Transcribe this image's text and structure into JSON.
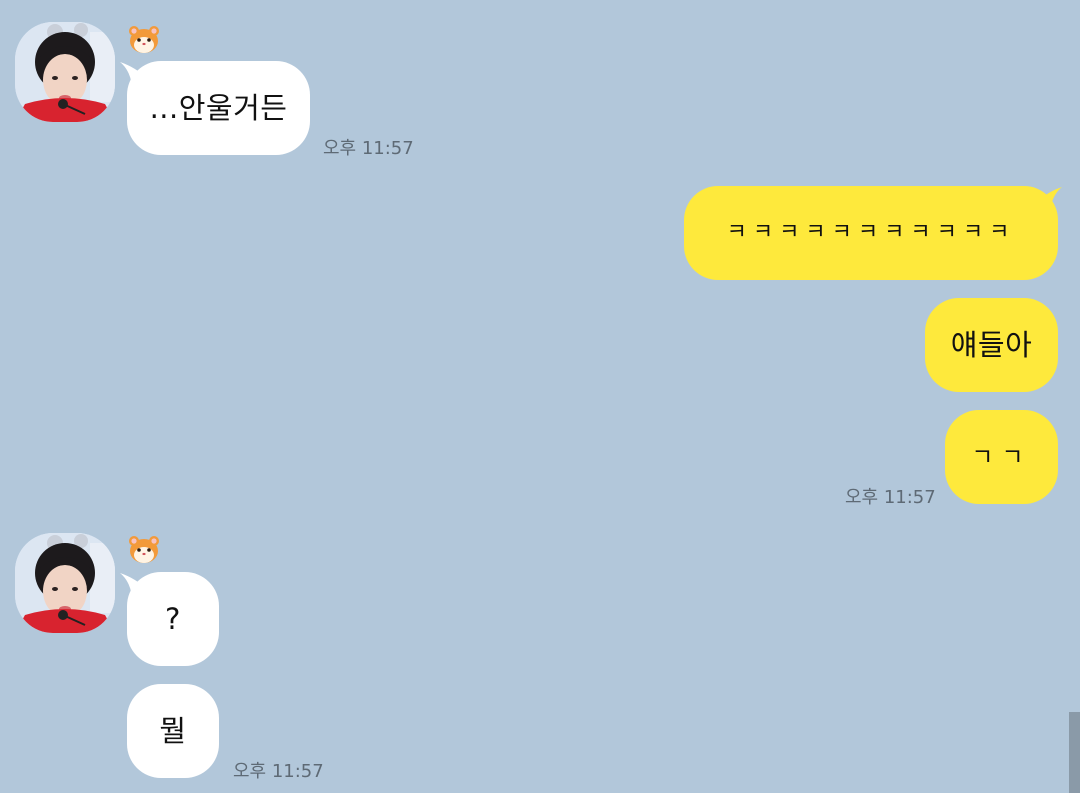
{
  "theme": {
    "background": "#b2c7da",
    "incoming_bubble": "#ffffff",
    "outgoing_bubble": "#fee93c",
    "time_color": "#5e6a75"
  },
  "messages": {
    "group1": {
      "sender_icon": "hamster-icon",
      "bubble1": "...안울거든",
      "time": "오후 11:57"
    },
    "group2": {
      "bubble1": "ㅋㅋㅋㅋㅋㅋㅋㅋㅋㅋㅋ",
      "bubble2": "얘들아",
      "bubble3": "ㄱㄱ",
      "time": "오후 11:57"
    },
    "group3": {
      "sender_icon": "hamster-icon",
      "bubble1": "?",
      "bubble2": "뭘",
      "time": "오후 11:57"
    }
  }
}
